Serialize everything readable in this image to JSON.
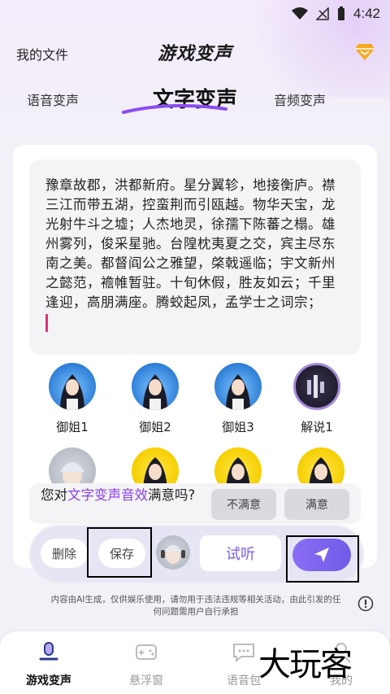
{
  "status_bar": {
    "time": "4:42"
  },
  "header": {
    "my_files": "我的文件",
    "title": "游戏变声"
  },
  "tabs": {
    "voice_change": "语音变声",
    "text_change": "文字变声",
    "audio_change": "音频变声"
  },
  "text_input": {
    "content": "豫章故郡，洪都新府。星分翼轸，地接衡庐。襟三江而带五湖，控蛮荆而引瓯越。物华天宝，龙光射牛斗之墟；人杰地灵，徐孺下陈蕃之榻。雄州雾列，俊采星驰。台隍枕夷夏之交，宾主尽东南之美。都督阎公之雅望，棨戟遥临；宇文新州之懿范，襜帷暂驻。十旬休假，胜友如云；千里逢迎，高朋满座。腾蛟起凤，孟学士之词宗；"
  },
  "voices": [
    {
      "label": "御姐1",
      "style": "blue"
    },
    {
      "label": "御姐2",
      "style": "blue"
    },
    {
      "label": "御姐3",
      "style": "blue"
    },
    {
      "label": "解说1",
      "style": "dark"
    }
  ],
  "feedback": {
    "prefix": "您对",
    "highlight": "文字变声音效",
    "suffix": "满意吗?",
    "dissatisfied": "不满意",
    "satisfied": "满意"
  },
  "actions": {
    "delete": "删除",
    "save": "保存",
    "listen": "试听"
  },
  "disclaimer": "内容由AI生成，仅供娱乐使用，请勿用于违法违规等相关活动，由此引发的任何问题需用户自行承担",
  "bottom_nav": {
    "items": [
      {
        "label": "游戏变声",
        "icon": "microphone-icon"
      },
      {
        "label": "悬浮窗",
        "icon": "gamepad-icon"
      },
      {
        "label": "语音包",
        "icon": "chat-bubble-icon"
      },
      {
        "label": "我的",
        "icon": "person-icon"
      }
    ]
  },
  "watermark": "大玩客",
  "colors": {
    "accent": "#7a5cf0",
    "highlight": "#8a3df0",
    "cursor": "#e0307a"
  }
}
